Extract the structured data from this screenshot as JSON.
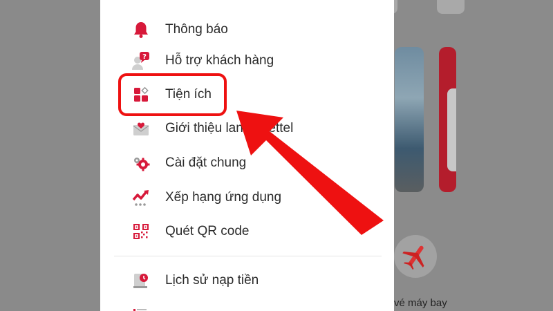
{
  "menu": {
    "items": [
      {
        "label": "Thông báo",
        "icon": "bell-icon"
      },
      {
        "label": "Hỗ trợ khách hàng",
        "icon": "support-icon"
      },
      {
        "label": "Tiện ích",
        "icon": "utilities-icon"
      },
      {
        "label": "Giới thiệu lan          y Viettel",
        "icon": "invite-mail-icon"
      },
      {
        "label": "Cài đặt chung",
        "icon": "settings-gear-icon"
      },
      {
        "label": "Xếp hạng ứng dụng",
        "icon": "rating-chart-icon"
      },
      {
        "label": "Quét QR code",
        "icon": "qr-code-icon"
      },
      {
        "label": "Lịch sử nạp tiền",
        "icon": "topup-history-icon"
      }
    ]
  },
  "background": {
    "flight_label": "vé máy bay"
  },
  "colors": {
    "accent": "#d7193a",
    "annotation": "#ee1111"
  }
}
